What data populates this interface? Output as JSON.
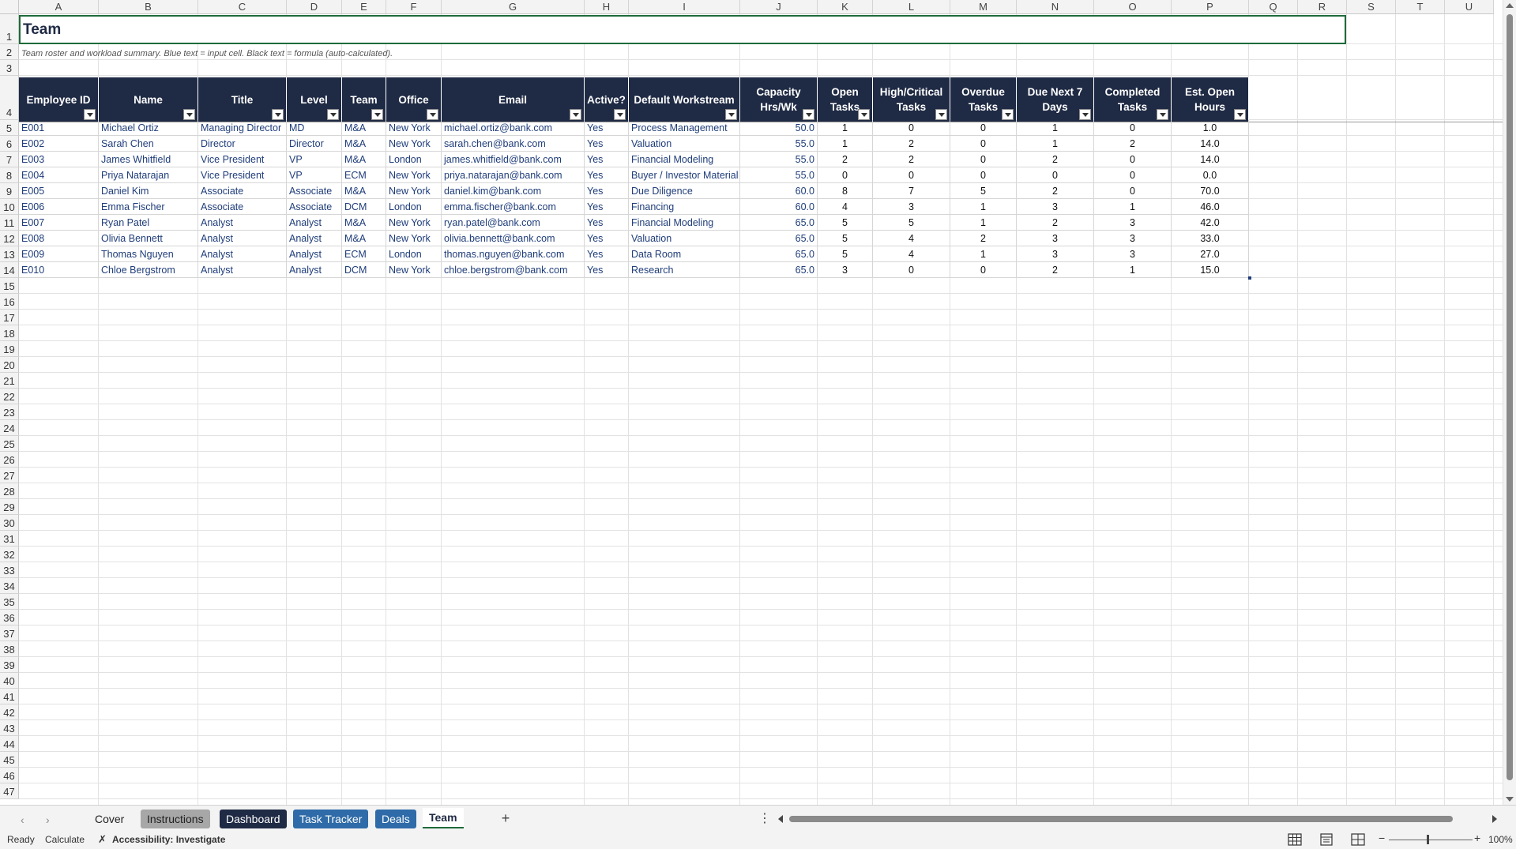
{
  "columns": [
    "A",
    "B",
    "C",
    "D",
    "E",
    "F",
    "G",
    "H",
    "I",
    "J",
    "K",
    "L",
    "M",
    "N",
    "O",
    "P",
    "Q",
    "R",
    "S",
    "T",
    "U"
  ],
  "rows_visible": [
    "1",
    "2",
    "3",
    "4",
    "5",
    "6",
    "7",
    "8",
    "9",
    "10",
    "11",
    "12",
    "13",
    "14",
    "15",
    "16",
    "17",
    "18",
    "19",
    "20",
    "21",
    "22",
    "23",
    "24",
    "25",
    "26",
    "27",
    "28",
    "29",
    "30",
    "31",
    "32",
    "33",
    "34",
    "35",
    "36",
    "37",
    "38",
    "39",
    "40",
    "41",
    "42",
    "43",
    "44",
    "45",
    "46",
    "47"
  ],
  "sheet": {
    "title": "Team",
    "subtitle": "Team roster and workload summary. Blue text = input cell. Black text = formula (auto-calculated)."
  },
  "table": {
    "headers": [
      "Employee ID",
      "Name",
      "Title",
      "Level",
      "Team",
      "Office",
      "Email",
      "Active?",
      "Default Workstream",
      "Capacity Hrs/Wk",
      "Open Tasks",
      "High/Critical Tasks",
      "Overdue Tasks",
      "Due Next 7 Days",
      "Completed Tasks",
      "Est. Open Hours"
    ],
    "rows": [
      [
        "E001",
        "Michael Ortiz",
        "Managing Director",
        "MD",
        "M&A",
        "New York",
        "michael.ortiz@bank.com",
        "Yes",
        "Process Management",
        "50.0",
        "1",
        "0",
        "0",
        "1",
        "0",
        "1.0"
      ],
      [
        "E002",
        "Sarah Chen",
        "Director",
        "Director",
        "M&A",
        "New York",
        "sarah.chen@bank.com",
        "Yes",
        "Valuation",
        "55.0",
        "1",
        "2",
        "0",
        "1",
        "2",
        "14.0"
      ],
      [
        "E003",
        "James Whitfield",
        "Vice President",
        "VP",
        "M&A",
        "London",
        "james.whitfield@bank.com",
        "Yes",
        "Financial Modeling",
        "55.0",
        "2",
        "2",
        "0",
        "2",
        "0",
        "14.0"
      ],
      [
        "E004",
        "Priya Natarajan",
        "Vice President",
        "VP",
        "ECM",
        "New York",
        "priya.natarajan@bank.com",
        "Yes",
        "Buyer / Investor Material",
        "55.0",
        "0",
        "0",
        "0",
        "0",
        "0",
        "0.0"
      ],
      [
        "E005",
        "Daniel Kim",
        "Associate",
        "Associate",
        "M&A",
        "New York",
        "daniel.kim@bank.com",
        "Yes",
        "Due Diligence",
        "60.0",
        "8",
        "7",
        "5",
        "2",
        "0",
        "70.0"
      ],
      [
        "E006",
        "Emma Fischer",
        "Associate",
        "Associate",
        "DCM",
        "London",
        "emma.fischer@bank.com",
        "Yes",
        "Financing",
        "60.0",
        "4",
        "3",
        "1",
        "3",
        "1",
        "46.0"
      ],
      [
        "E007",
        "Ryan Patel",
        "Analyst",
        "Analyst",
        "M&A",
        "New York",
        "ryan.patel@bank.com",
        "Yes",
        "Financial Modeling",
        "65.0",
        "5",
        "5",
        "1",
        "2",
        "3",
        "42.0"
      ],
      [
        "E008",
        "Olivia Bennett",
        "Analyst",
        "Analyst",
        "M&A",
        "New York",
        "olivia.bennett@bank.com",
        "Yes",
        "Valuation",
        "65.0",
        "5",
        "4",
        "2",
        "3",
        "3",
        "33.0"
      ],
      [
        "E009",
        "Thomas Nguyen",
        "Analyst",
        "Analyst",
        "ECM",
        "London",
        "thomas.nguyen@bank.com",
        "Yes",
        "Data Room",
        "65.0",
        "5",
        "4",
        "1",
        "3",
        "3",
        "27.0"
      ],
      [
        "E010",
        "Chloe Bergstrom",
        "Analyst",
        "Analyst",
        "DCM",
        "New York",
        "chloe.bergstrom@bank.com",
        "Yes",
        "Research",
        "65.0",
        "3",
        "0",
        "0",
        "2",
        "1",
        "15.0"
      ]
    ]
  },
  "tabs": [
    {
      "label": "Cover",
      "style": "plain"
    },
    {
      "label": "Instructions",
      "style": "grey"
    },
    {
      "label": "Dashboard",
      "style": "navy"
    },
    {
      "label": "Task Tracker",
      "style": "blue"
    },
    {
      "label": "Deals",
      "style": "blue"
    },
    {
      "label": "Team",
      "style": "active"
    }
  ],
  "status": {
    "ready": "Ready",
    "calculate": "Calculate",
    "accessibility": "Accessibility: Investigate",
    "zoom": "100%"
  },
  "colors": {
    "header_bg": "#1f2a44",
    "input_text": "#1f3d7a",
    "formula_text": "#111111",
    "selection": "#1e6b3a"
  }
}
